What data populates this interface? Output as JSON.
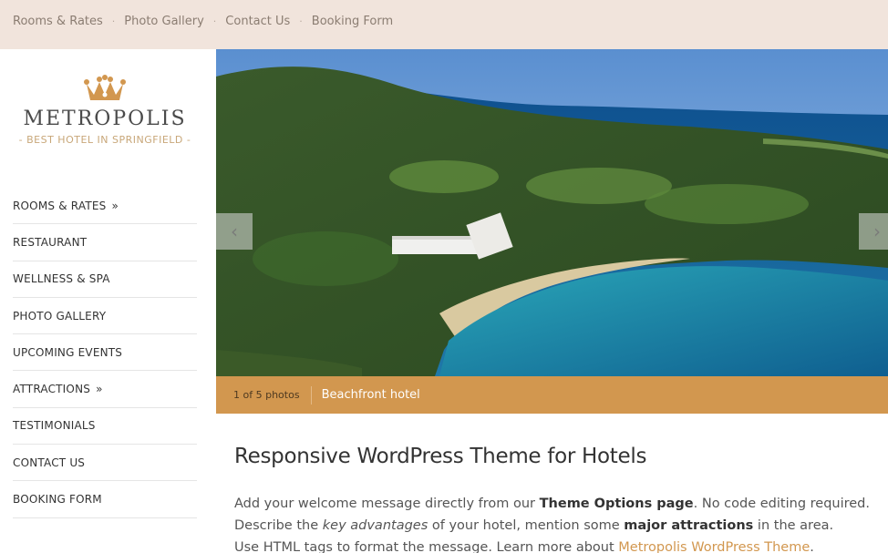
{
  "top_nav": {
    "items": [
      "Rooms & Rates",
      "Photo Gallery",
      "Contact Us",
      "Booking Form"
    ],
    "separator": "·"
  },
  "logo": {
    "title": "METROPOLIS",
    "tagline": "- BEST HOTEL IN SPRINGFIELD -",
    "icon": "crown-icon"
  },
  "sidebar_menu": [
    {
      "label": "ROOMS & RATES",
      "arrow": "»"
    },
    {
      "label": "RESTAURANT",
      "arrow": ""
    },
    {
      "label": "WELLNESS & SPA",
      "arrow": ""
    },
    {
      "label": "PHOTO GALLERY",
      "arrow": ""
    },
    {
      "label": "UPCOMING EVENTS",
      "arrow": ""
    },
    {
      "label": "ATTRACTIONS",
      "arrow": "»"
    },
    {
      "label": "TESTIMONIALS",
      "arrow": ""
    },
    {
      "label": "CONTACT US",
      "arrow": ""
    },
    {
      "label": "BOOKING FORM",
      "arrow": ""
    }
  ],
  "slider": {
    "prev_icon": "chevron-left-icon",
    "next_icon": "chevron-right-icon",
    "count": "1 of 5 photos",
    "title": "Beachfront hotel"
  },
  "content": {
    "heading": "Responsive WordPress Theme for Hotels",
    "p1_a": "Add your welcome message directly from our ",
    "p1_b": "Theme Options page",
    "p1_c": ". No code editing required.",
    "p2_a": "Describe the ",
    "p2_b": "key advantages",
    "p2_c": " of your hotel, mention some ",
    "p2_d": "major attractions",
    "p2_e": " in the area.",
    "p3_a": "Use HTML tags to format the message. Learn more about ",
    "p3_link": "Metropolis WordPress Theme",
    "p3_c": "."
  },
  "colors": {
    "topbar_bg": "#f1e4dc",
    "accent": "#d2974f",
    "text": "#333333"
  }
}
